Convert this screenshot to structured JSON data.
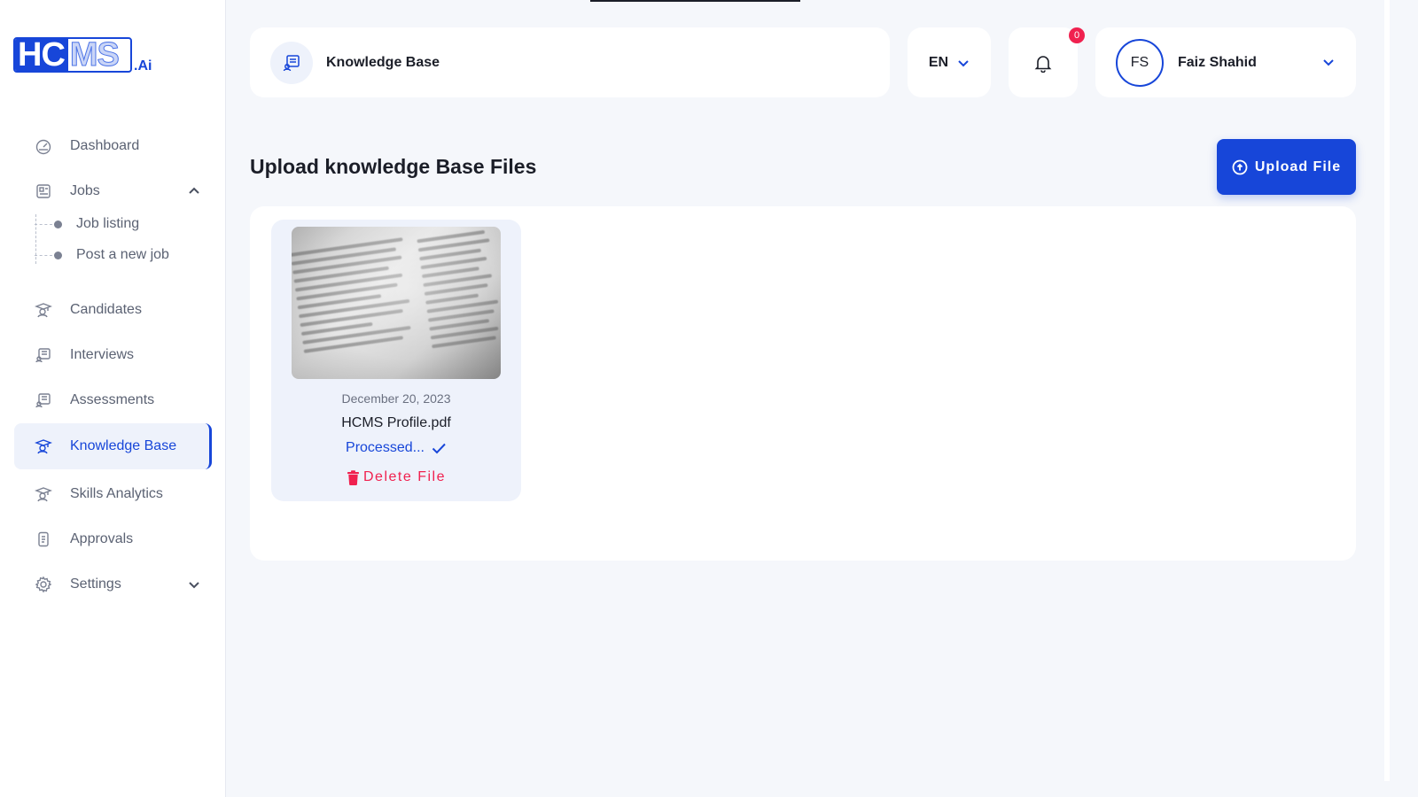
{
  "logo": {
    "part1": "HC",
    "part2": "MS",
    "suffix": ".Ai"
  },
  "sidebar": {
    "items": [
      {
        "label": "Dashboard",
        "icon": "dashboard-icon"
      },
      {
        "label": "Jobs",
        "icon": "jobs-icon",
        "expanded": true
      },
      {
        "label": "Candidates",
        "icon": "candidates-icon"
      },
      {
        "label": "Interviews",
        "icon": "interviews-icon"
      },
      {
        "label": "Assessments",
        "icon": "assessments-icon"
      },
      {
        "label": "Knowledge Base",
        "icon": "knowledge-base-icon",
        "active": true
      },
      {
        "label": "Skills Analytics",
        "icon": "skills-analytics-icon"
      },
      {
        "label": "Approvals",
        "icon": "approvals-icon"
      },
      {
        "label": "Settings",
        "icon": "settings-icon",
        "expanded": false
      }
    ],
    "jobs_sub": [
      {
        "label": "Job listing"
      },
      {
        "label": "Post a new job"
      }
    ]
  },
  "header": {
    "title": "Knowledge Base",
    "language": "EN",
    "notifications_count": "0",
    "user": {
      "initials": "FS",
      "name": "Faiz Shahid"
    }
  },
  "main": {
    "page_title": "Upload knowledge Base Files",
    "upload_label": "Upload File",
    "files": [
      {
        "date": "December 20, 2023",
        "name": "HCMS Profile.pdf",
        "status": "Processed...",
        "delete_label": "Delete File"
      }
    ]
  },
  "colors": {
    "accent": "#1746d9",
    "danger": "#f0214f",
    "background": "#f5f7fb",
    "active_bg": "#eef2fb"
  }
}
